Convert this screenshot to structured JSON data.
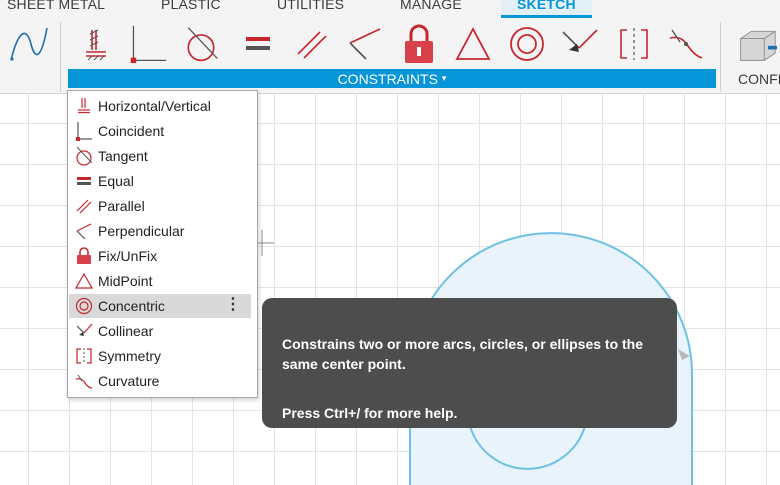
{
  "tabs": [
    {
      "label": "SHEET METAL",
      "active": false
    },
    {
      "label": "PLASTIC",
      "active": false
    },
    {
      "label": "UTILITIES",
      "active": false
    },
    {
      "label": "MANAGE",
      "active": false
    },
    {
      "label": "SKETCH",
      "active": true
    }
  ],
  "toolbar": {
    "group_label": "CONSTRAINTS",
    "group_caret": "▾",
    "next_group_label": "CONFI",
    "icons": [
      "spline-icon",
      "horizontal-vertical-icon",
      "coincident-icon",
      "tangent-icon",
      "equal-icon",
      "parallel-icon",
      "perpendicular-icon",
      "fix-unfix-lock-icon",
      "midpoint-icon",
      "concentric-icon",
      "collinear-icon",
      "symmetry-icon",
      "curvature-icon",
      "configure-box-icon"
    ]
  },
  "menu": {
    "items": [
      {
        "label": "Horizontal/Vertical",
        "icon": "horizontal-vertical-icon"
      },
      {
        "label": "Coincident",
        "icon": "coincident-icon"
      },
      {
        "label": "Tangent",
        "icon": "tangent-icon"
      },
      {
        "label": "Equal",
        "icon": "equal-icon"
      },
      {
        "label": "Parallel",
        "icon": "parallel-icon"
      },
      {
        "label": "Perpendicular",
        "icon": "perpendicular-icon"
      },
      {
        "label": "Fix/UnFix",
        "icon": "fix-unfix-lock-icon"
      },
      {
        "label": "MidPoint",
        "icon": "midpoint-icon"
      },
      {
        "label": "Concentric",
        "icon": "concentric-icon",
        "highlighted": true
      },
      {
        "label": "Collinear",
        "icon": "collinear-icon"
      },
      {
        "label": "Symmetry",
        "icon": "symmetry-icon"
      },
      {
        "label": "Curvature",
        "icon": "curvature-icon"
      }
    ],
    "kebab": "⋮"
  },
  "tooltip": {
    "description": "Constrains two or more arcs, circles, or ellipses to the same center point.",
    "help": "Press Ctrl+/ for more help."
  },
  "colors": {
    "accent": "#0696d7",
    "constraint_red": "#c8262f",
    "sketch_profile_stroke": "#6ec1e4",
    "sketch_profile_fill": "#e8f3fb",
    "tooltip_bg": "#4d4d4d",
    "menu_highlight": "#d9d9d9"
  }
}
